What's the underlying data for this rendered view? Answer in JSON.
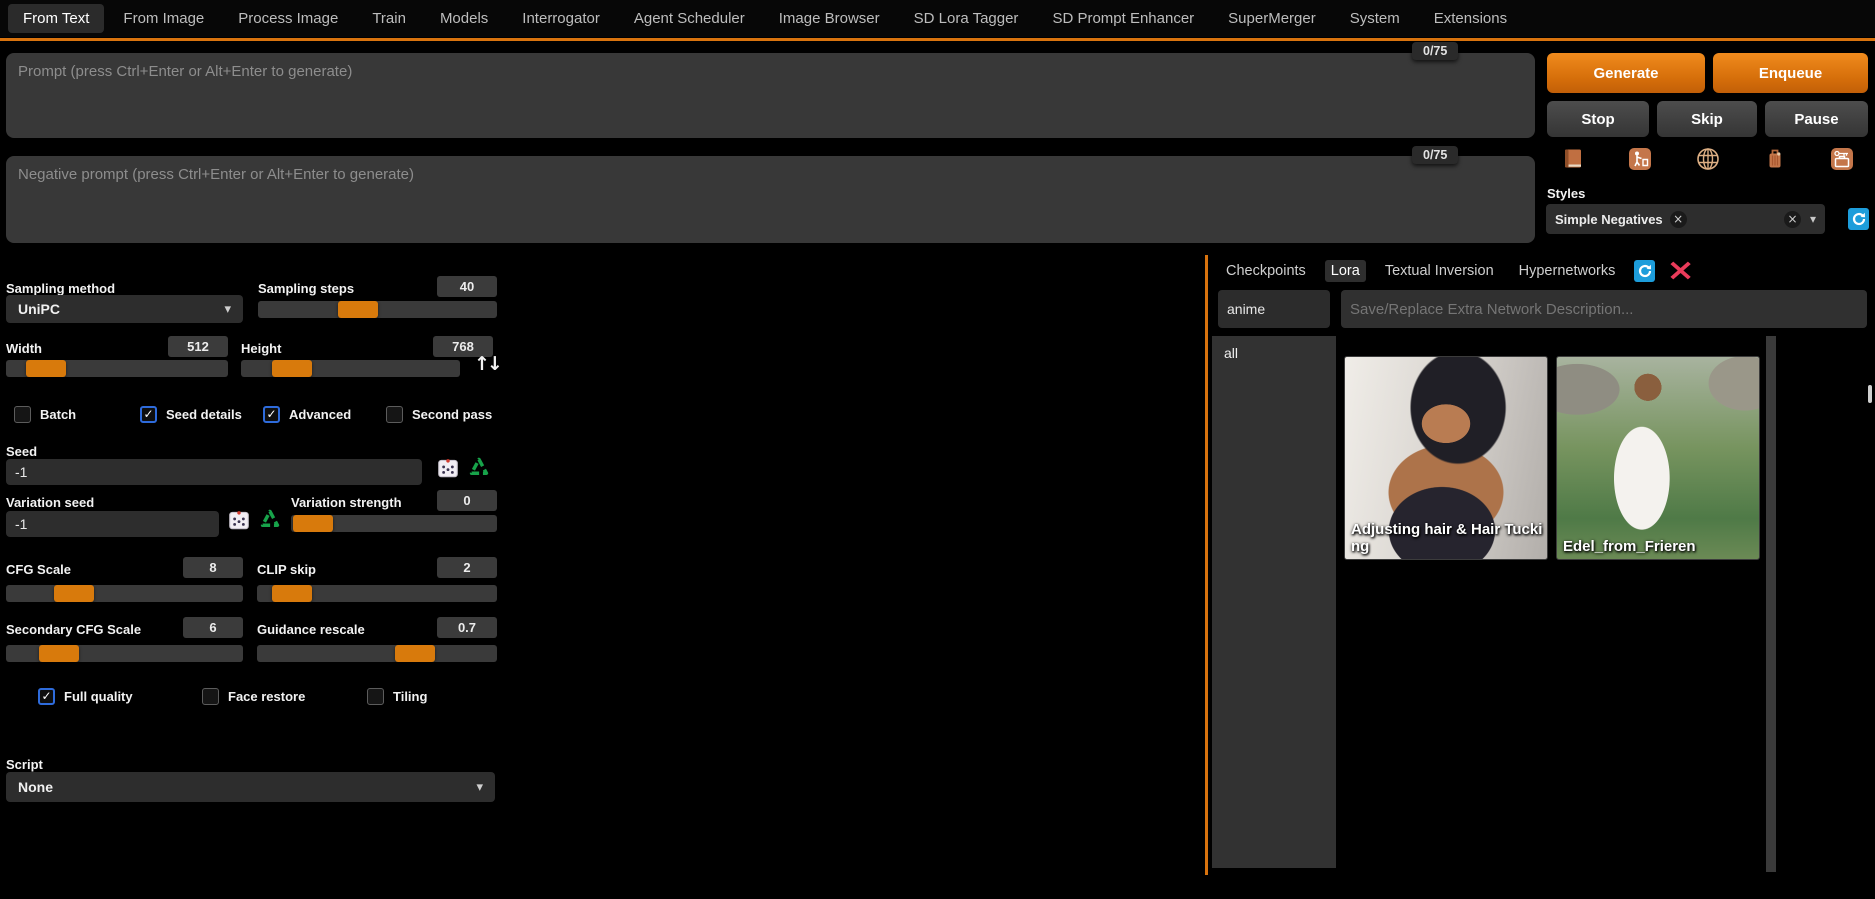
{
  "tabbar": {
    "items": [
      "From Text",
      "From Image",
      "Process Image",
      "Train",
      "Models",
      "Interrogator",
      "Agent Scheduler",
      "Image Browser",
      "SD Lora Tagger",
      "SD Prompt Enhancer",
      "SuperMerger",
      "System",
      "Extensions"
    ],
    "active": "From Text"
  },
  "prompt": {
    "placeholder": "Prompt (press Ctrl+Enter or Alt+Enter to generate)",
    "counter": "0/75"
  },
  "negative": {
    "placeholder": "Negative prompt (press Ctrl+Enter or Alt+Enter to generate)",
    "counter": "0/75"
  },
  "actions": {
    "generate": "Generate",
    "enqueue": "Enqueue",
    "stop": "Stop",
    "skip": "Skip",
    "pause": "Pause"
  },
  "quick_icons": [
    "notebook",
    "litter-bin",
    "globe",
    "luggage",
    "left-luggage"
  ],
  "styles": {
    "label": "Styles",
    "tag": "Simple Negatives"
  },
  "params": {
    "sampling_method_label": "Sampling method",
    "sampling_method": "UniPC",
    "sampling_steps_label": "Sampling steps",
    "sampling_steps": "40",
    "width_label": "Width",
    "width": "512",
    "height_label": "Height",
    "height": "768",
    "batch": "Batch",
    "seed_details": "Seed details",
    "advanced": "Advanced",
    "second_pass": "Second pass",
    "seed_label": "Seed",
    "seed": "-1",
    "variation_seed_label": "Variation seed",
    "variation_seed": "-1",
    "variation_strength_label": "Variation strength",
    "variation_strength": "0",
    "cfg_label": "CFG Scale",
    "cfg": "8",
    "clip_label": "CLIP skip",
    "clip": "2",
    "cfg2_label": "Secondary CFG Scale",
    "cfg2": "6",
    "rescale_label": "Guidance rescale",
    "rescale": "0.7",
    "full_quality": "Full quality",
    "face_restore": "Face restore",
    "tiling": "Tiling",
    "script_label": "Script",
    "script": "None"
  },
  "checkbox_states": {
    "batch": false,
    "seed_details": true,
    "advanced": true,
    "second_pass": false,
    "full_quality": true,
    "face_restore": false,
    "tiling": false
  },
  "networks": {
    "tabs": [
      "Checkpoints",
      "Lora",
      "Textual Inversion",
      "Hypernetworks"
    ],
    "active_tab": "Lora",
    "search": "anime",
    "description_placeholder": "Save/Replace Extra Network Description...",
    "folder": "all",
    "cards": [
      {
        "title": "Adjusting hair & Hair Tucking"
      },
      {
        "title": "Edel_from_Frieren"
      }
    ]
  },
  "colors": {
    "accent": "#d8730e",
    "slider_handle": "#d87a0c",
    "checked_border": "#2e6bdb",
    "refresh_blue": "#1d9ddb",
    "close_red": "#ea3b5a",
    "generate_gradient_top": "#f08b1d"
  }
}
